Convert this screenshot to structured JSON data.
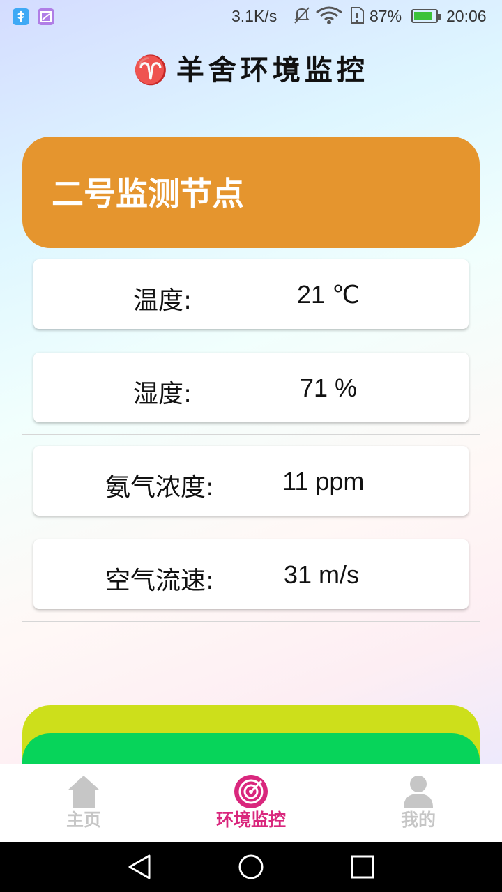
{
  "status_bar": {
    "network_speed": "3.1K/s",
    "battery_percent": "87%",
    "battery_level": 0.87,
    "time": "20:06",
    "icons": [
      "usb-icon",
      "image-icon",
      "mute-icon",
      "wifi-icon",
      "sim-icon",
      "battery-icon"
    ]
  },
  "header": {
    "title": "羊舍环境监控",
    "logo_icon": "ram-horns-icon",
    "logo_glyph": "♈"
  },
  "node": {
    "title": "二号监测节点",
    "color": "#e5952e"
  },
  "readings": [
    {
      "label": "温度:",
      "value": "21 ℃"
    },
    {
      "label": "湿度:",
      "value": "71 %"
    },
    {
      "label": "氨气浓度:",
      "value": "11 ppm"
    },
    {
      "label": "空气流速:",
      "value": "31 m/s"
    }
  ],
  "bottom_cards": {
    "yellow_color": "#cddf1b",
    "green_color": "#07d45a"
  },
  "tabbar": {
    "active_color": "#d9277d",
    "inactive_color": "#c6c6c6",
    "tabs": [
      {
        "label": "主页",
        "icon": "home-icon",
        "active": false
      },
      {
        "label": "环境监控",
        "icon": "target-gauge-icon",
        "active": true
      },
      {
        "label": "我的",
        "icon": "user-icon",
        "active": false
      }
    ]
  },
  "navbar": {
    "buttons": [
      "back-icon",
      "home-circle-icon",
      "recents-square-icon"
    ]
  }
}
